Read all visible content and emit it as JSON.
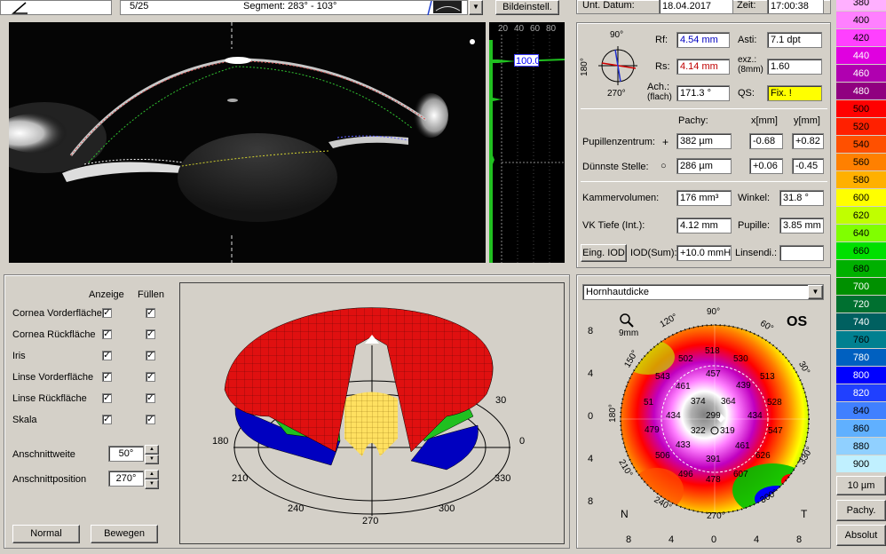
{
  "topbar": {
    "frame": "5/25",
    "segment": "Segment: 283° - 103°",
    "image_settings_button": "Bildeinstell."
  },
  "scheimpflug": {
    "scale_ticks": [
      "20",
      "40",
      "60",
      "80"
    ],
    "value_box": "100.0"
  },
  "exam": {
    "date_label": "Unt. Datum:",
    "date": "18.04.2017",
    "time_label": "Zeit:",
    "time": "17:00:38"
  },
  "keratometry": {
    "compass": {
      "top": "90°",
      "bottom": "270°",
      "left": "180°"
    },
    "rf_label": "Rf:",
    "rf": "4.54 mm",
    "rs_label": "Rs:",
    "rs": "4.14 mm",
    "axis_label": "Ach.:",
    "axis_sub": "(flach)",
    "axis": "171.3 °",
    "asti_label": "Asti:",
    "asti": "7.1 dpt",
    "exz_label": "exz.:",
    "exz_sub": "(8mm)",
    "exz": "1.60",
    "qs_label": "QS:",
    "qs": "Fix. !"
  },
  "pachy": {
    "header_pachy": "Pachy:",
    "header_x": "x[mm]",
    "header_y": "y[mm]",
    "pupil_label": "Pupillenzentrum:",
    "pupil_symbol": "+",
    "pupil_pachy": "382 µm",
    "pupil_x": "-0.68",
    "pupil_y": "+0.82",
    "thin_label": "Dünnste Stelle:",
    "thin_symbol": "○",
    "thin_pachy": "286 µm",
    "thin_x": "+0.06",
    "thin_y": "-0.45"
  },
  "chamber": {
    "volume_label": "Kammervolumen:",
    "volume": "176 mm³",
    "angle_label": "Winkel:",
    "angle": "31.8 °",
    "depth_label": "VK Tiefe (Int.):",
    "depth": "4.12 mm",
    "pupil_label": "Pupille:",
    "pupil": "3.85 mm",
    "iod_button": "Eing. IOD",
    "iod_label": "IOD(Sum):",
    "iod": "+10.0 mmHg",
    "lens_label": "Linsendi.:",
    "lens": ""
  },
  "layers": {
    "col_show": "Anzeige",
    "col_fill": "Füllen",
    "items": [
      {
        "label": "Cornea Vorderfläche"
      },
      {
        "label": "Cornea Rückfläche"
      },
      {
        "label": "Iris"
      },
      {
        "label": "Linse Vorderfläche"
      },
      {
        "label": "Linse Rückfläche"
      },
      {
        "label": "Skala"
      }
    ],
    "cut_width_label": "Anschnittweite",
    "cut_width": "50°",
    "cut_pos_label": "Anschnittposition",
    "cut_pos": "270°",
    "normal_button": "Normal",
    "move_button": "Bewegen"
  },
  "model3d": {
    "angles": {
      "a0": "0",
      "a30": "30",
      "a180": "180",
      "a210": "210",
      "a240": "240",
      "a270": "270",
      "a300": "300",
      "a330": "330"
    }
  },
  "pachymap": {
    "map_select": "Hornhautdicke",
    "eye": "OS",
    "zoom": "9mm",
    "axis_left": [
      "8",
      "4",
      "0",
      "4",
      "8"
    ],
    "axis_bottom": [
      "8",
      "4",
      "0",
      "4",
      "8"
    ],
    "nasal": "N",
    "temporal": "T",
    "angle_labels": {
      "a90": "90°",
      "a120": "120°",
      "a150": "150°",
      "a180": "180°",
      "a210": "210°",
      "a240": "240°",
      "a270": "270°",
      "a300": "300°",
      "a330": "330°",
      "a60": "60°",
      "a30": "30°"
    },
    "values": {
      "v518": "518",
      "v530": "530",
      "v502": "502",
      "v543": "543",
      "v457": "457",
      "v439": "439",
      "v513": "513",
      "v461a": "461",
      "v374": "374",
      "v364": "364",
      "v528": "528",
      "v51": "51",
      "v434a": "434",
      "v299": "299",
      "v434b": "434",
      "v479": "479",
      "v322": "322",
      "v319": "319",
      "v547": "547",
      "v433": "433",
      "v461b": "461",
      "v506": "506",
      "v391": "391",
      "v626": "626",
      "v496": "496",
      "v478": "478",
      "v607": "607"
    }
  },
  "colorscale": {
    "items": [
      {
        "label": "380",
        "color": "#ffb0ff"
      },
      {
        "label": "400",
        "color": "#ff80ff"
      },
      {
        "label": "420",
        "color": "#ff40ff"
      },
      {
        "label": "440",
        "color": "#e000e0"
      },
      {
        "label": "460",
        "color": "#b000b0"
      },
      {
        "label": "480",
        "color": "#900080"
      },
      {
        "label": "500",
        "color": "#ff0000"
      },
      {
        "label": "520",
        "color": "#ff2000"
      },
      {
        "label": "540",
        "color": "#ff5000"
      },
      {
        "label": "560",
        "color": "#ff8000"
      },
      {
        "label": "580",
        "color": "#ffb000"
      },
      {
        "label": "600",
        "color": "#ffff00"
      },
      {
        "label": "620",
        "color": "#c0ff00"
      },
      {
        "label": "640",
        "color": "#80ff00"
      },
      {
        "label": "660",
        "color": "#00e000"
      },
      {
        "label": "680",
        "color": "#00b000"
      },
      {
        "label": "700",
        "color": "#009000"
      },
      {
        "label": "720",
        "color": "#007030"
      },
      {
        "label": "740",
        "color": "#006060"
      },
      {
        "label": "760",
        "color": "#008090"
      },
      {
        "label": "780",
        "color": "#0060c0"
      },
      {
        "label": "800",
        "color": "#0000ff"
      },
      {
        "label": "820",
        "color": "#2040ff"
      },
      {
        "label": "840",
        "color": "#4080ff"
      },
      {
        "label": "860",
        "color": "#60b0ff"
      },
      {
        "label": "880",
        "color": "#90d0ff"
      },
      {
        "label": "900",
        "color": "#c0f0ff"
      }
    ],
    "unit_button": "10 µm",
    "pachy_button": "Pachy.",
    "absolute_button": "Absolut"
  }
}
